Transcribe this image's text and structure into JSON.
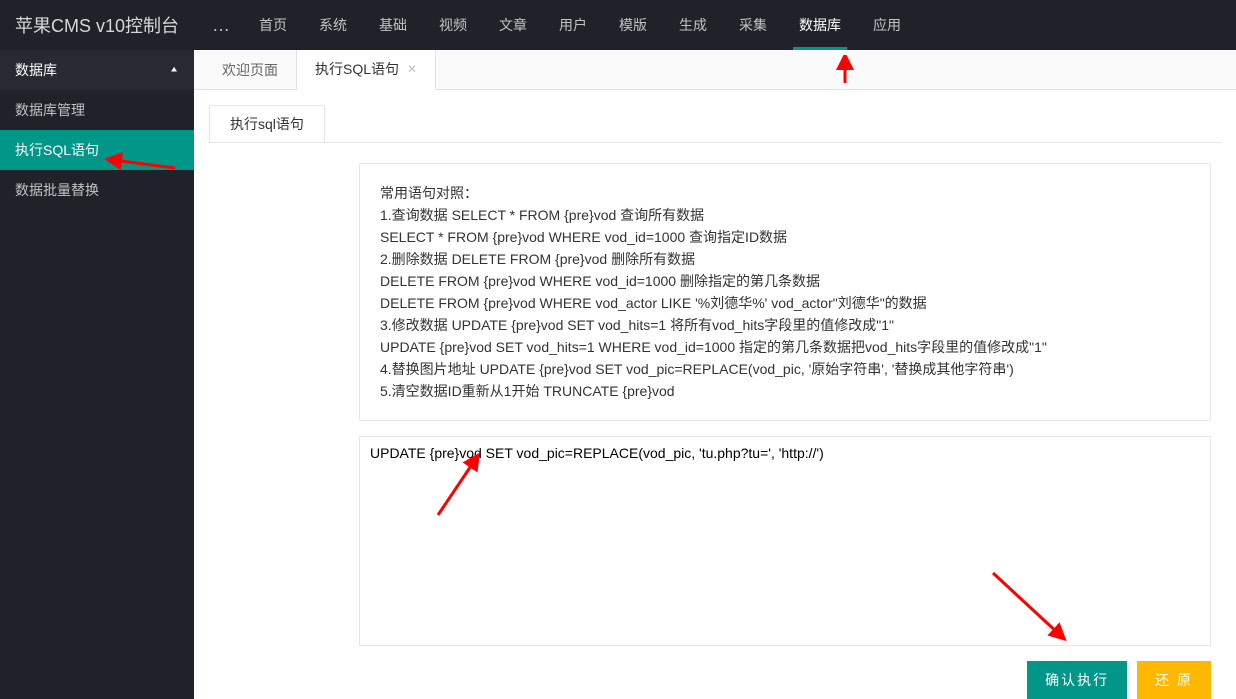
{
  "brand": "苹果CMS v10控制台",
  "brand_more": "…",
  "top_menu": [
    {
      "label": "首页",
      "active": false
    },
    {
      "label": "系统",
      "active": false
    },
    {
      "label": "基础",
      "active": false
    },
    {
      "label": "视频",
      "active": false
    },
    {
      "label": "文章",
      "active": false
    },
    {
      "label": "用户",
      "active": false
    },
    {
      "label": "模版",
      "active": false
    },
    {
      "label": "生成",
      "active": false
    },
    {
      "label": "采集",
      "active": false
    },
    {
      "label": "数据库",
      "active": true
    },
    {
      "label": "应用",
      "active": false
    }
  ],
  "sidebar": {
    "group_label": "数据库",
    "items": [
      {
        "label": "数据库管理",
        "active": false
      },
      {
        "label": "执行SQL语句",
        "active": true
      },
      {
        "label": "数据批量替换",
        "active": false
      }
    ]
  },
  "tabs": [
    {
      "label": "欢迎页面",
      "closable": false,
      "active": false
    },
    {
      "label": "执行SQL语句",
      "closable": true,
      "active": true
    }
  ],
  "inner_tab_label": "执行sql语句",
  "help_lines": [
    "常用语句对照：",
    "1.查询数据 SELECT * FROM {pre}vod 查询所有数据",
    "SELECT * FROM {pre}vod WHERE vod_id=1000 查询指定ID数据",
    "2.删除数据 DELETE FROM {pre}vod 删除所有数据",
    "DELETE FROM {pre}vod WHERE vod_id=1000 删除指定的第几条数据",
    "DELETE FROM {pre}vod WHERE vod_actor LIKE '%刘德华%' vod_actor\"刘德华\"的数据",
    "3.修改数据 UPDATE {pre}vod SET vod_hits=1 将所有vod_hits字段里的值修改成\"1\"",
    "UPDATE {pre}vod SET vod_hits=1 WHERE vod_id=1000 指定的第几条数据把vod_hits字段里的值修改成\"1\"",
    "4.替换图片地址 UPDATE {pre}vod SET vod_pic=REPLACE(vod_pic, '原始字符串', '替换成其他字符串')",
    "5.清空数据ID重新从1开始 TRUNCATE {pre}vod"
  ],
  "sql_value": "UPDATE {pre}vod SET vod_pic=REPLACE(vod_pic, 'tu.php?tu=', 'http://') ",
  "buttons": {
    "confirm": "确认执行",
    "reset": "还 原"
  }
}
